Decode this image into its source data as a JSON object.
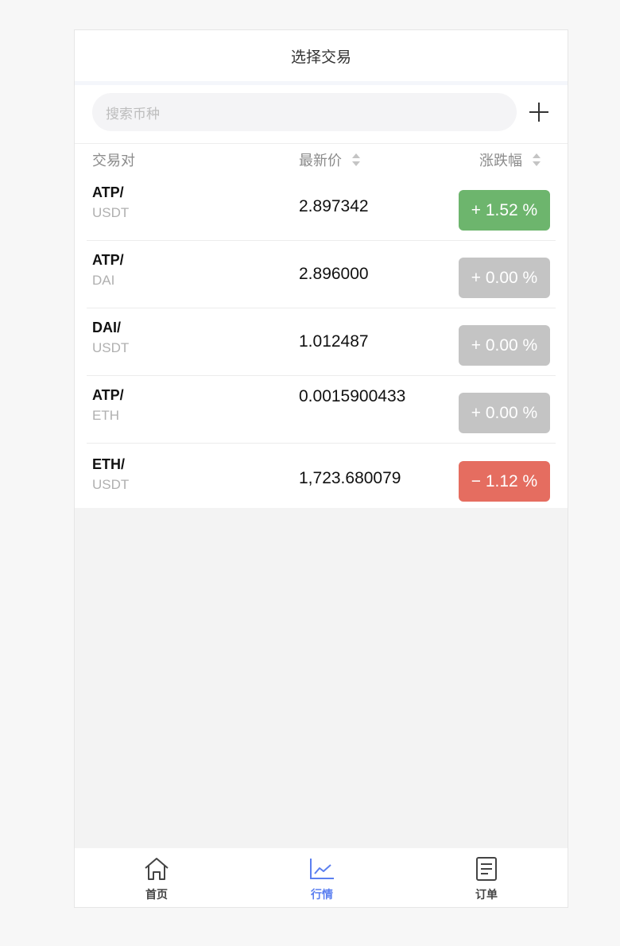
{
  "header": {
    "title": "选择交易"
  },
  "search": {
    "placeholder": "搜索币种"
  },
  "columns": {
    "pair": "交易对",
    "price": "最新价",
    "change": "涨跌幅"
  },
  "colors": {
    "up": "#6db56d",
    "flat": "#c4c4c4",
    "down": "#e56d60",
    "tab_active": "#5b7ff0",
    "tab_inactive": "#444444"
  },
  "rows": [
    {
      "base": "ATP/",
      "quote": "USDT",
      "price": "2.897342",
      "change": "+ 1.52 %",
      "trend": "up"
    },
    {
      "base": "ATP/",
      "quote": "DAI",
      "price": "2.896000",
      "change": "+ 0.00 %",
      "trend": "flat"
    },
    {
      "base": "DAI/",
      "quote": "USDT",
      "price": "1.012487",
      "change": "+ 0.00 %",
      "trend": "flat"
    },
    {
      "base": "ATP/",
      "quote": "ETH",
      "price": "0.0015900433",
      "change": "+ 0.00 %",
      "trend": "flat"
    },
    {
      "base": "ETH/",
      "quote": "USDT",
      "price": "1,723.680079",
      "change": "− 1.12 %",
      "trend": "down"
    }
  ],
  "tabs": [
    {
      "label": "首页",
      "icon": "home-icon",
      "active": false
    },
    {
      "label": "行情",
      "icon": "market-chart-icon",
      "active": true
    },
    {
      "label": "订单",
      "icon": "order-icon",
      "active": false
    }
  ]
}
